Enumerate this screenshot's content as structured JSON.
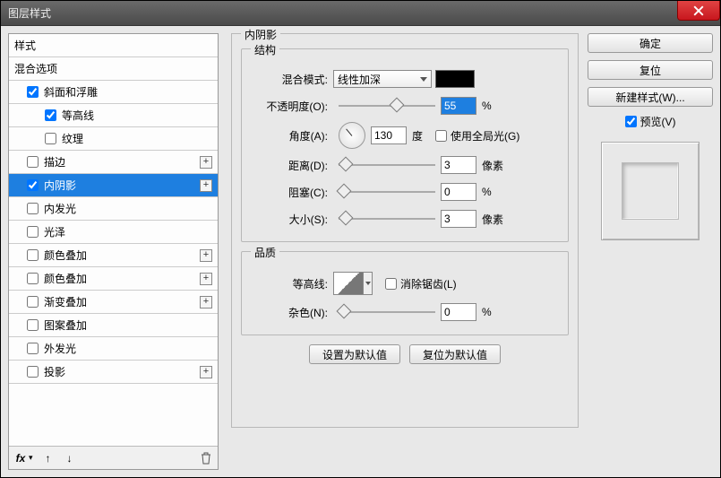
{
  "window": {
    "title": "图层样式"
  },
  "left": {
    "header": "样式",
    "blending": "混合选项",
    "items": [
      {
        "key": "bevel",
        "label": "斜面和浮雕",
        "checked": true,
        "indent": 1
      },
      {
        "key": "contour",
        "label": "等高线",
        "checked": true,
        "indent": 2
      },
      {
        "key": "texture",
        "label": "纹理",
        "checked": false,
        "indent": 2
      },
      {
        "key": "stroke",
        "label": "描边",
        "checked": false,
        "indent": 1,
        "plus": true
      },
      {
        "key": "inner-shadow",
        "label": "内阴影",
        "checked": true,
        "indent": 1,
        "plus": true,
        "selected": true
      },
      {
        "key": "inner-glow",
        "label": "内发光",
        "checked": false,
        "indent": 1
      },
      {
        "key": "satin",
        "label": "光泽",
        "checked": false,
        "indent": 1
      },
      {
        "key": "color-overlay",
        "label": "颜色叠加",
        "checked": false,
        "indent": 1,
        "plus": true
      },
      {
        "key": "color-overlay2",
        "label": "颜色叠加",
        "checked": false,
        "indent": 1,
        "plus": true
      },
      {
        "key": "gradient-overlay",
        "label": "渐变叠加",
        "checked": false,
        "indent": 1,
        "plus": true
      },
      {
        "key": "pattern-overlay",
        "label": "图案叠加",
        "checked": false,
        "indent": 1
      },
      {
        "key": "outer-glow",
        "label": "外发光",
        "checked": false,
        "indent": 1
      },
      {
        "key": "drop-shadow",
        "label": "投影",
        "checked": false,
        "indent": 1,
        "plus": true
      }
    ],
    "fx_icon": "fx"
  },
  "panel": {
    "title": "内阴影",
    "structure": {
      "title": "结构",
      "blend_mode_label": "混合模式:",
      "blend_mode_value": "线性加深",
      "color": "#000000",
      "opacity_label": "不透明度(O):",
      "opacity_value": "55",
      "opacity_unit": "%",
      "angle_label": "角度(A):",
      "angle_value": "130",
      "angle_unit": "度",
      "global_light_label": "使用全局光(G)",
      "global_light_checked": false,
      "distance_label": "距离(D):",
      "distance_value": "3",
      "distance_unit": "像素",
      "choke_label": "阻塞(C):",
      "choke_value": "0",
      "choke_unit": "%",
      "size_label": "大小(S):",
      "size_value": "3",
      "size_unit": "像素"
    },
    "quality": {
      "title": "品质",
      "contour_label": "等高线:",
      "antialias_label": "消除锯齿(L)",
      "antialias_checked": false,
      "noise_label": "杂色(N):",
      "noise_value": "0",
      "noise_unit": "%"
    },
    "buttons": {
      "make_default": "设置为默认值",
      "reset_default": "复位为默认值"
    }
  },
  "right": {
    "ok": "确定",
    "reset": "复位",
    "new_style": "新建样式(W)...",
    "preview_label": "预览(V)",
    "preview_checked": true
  }
}
